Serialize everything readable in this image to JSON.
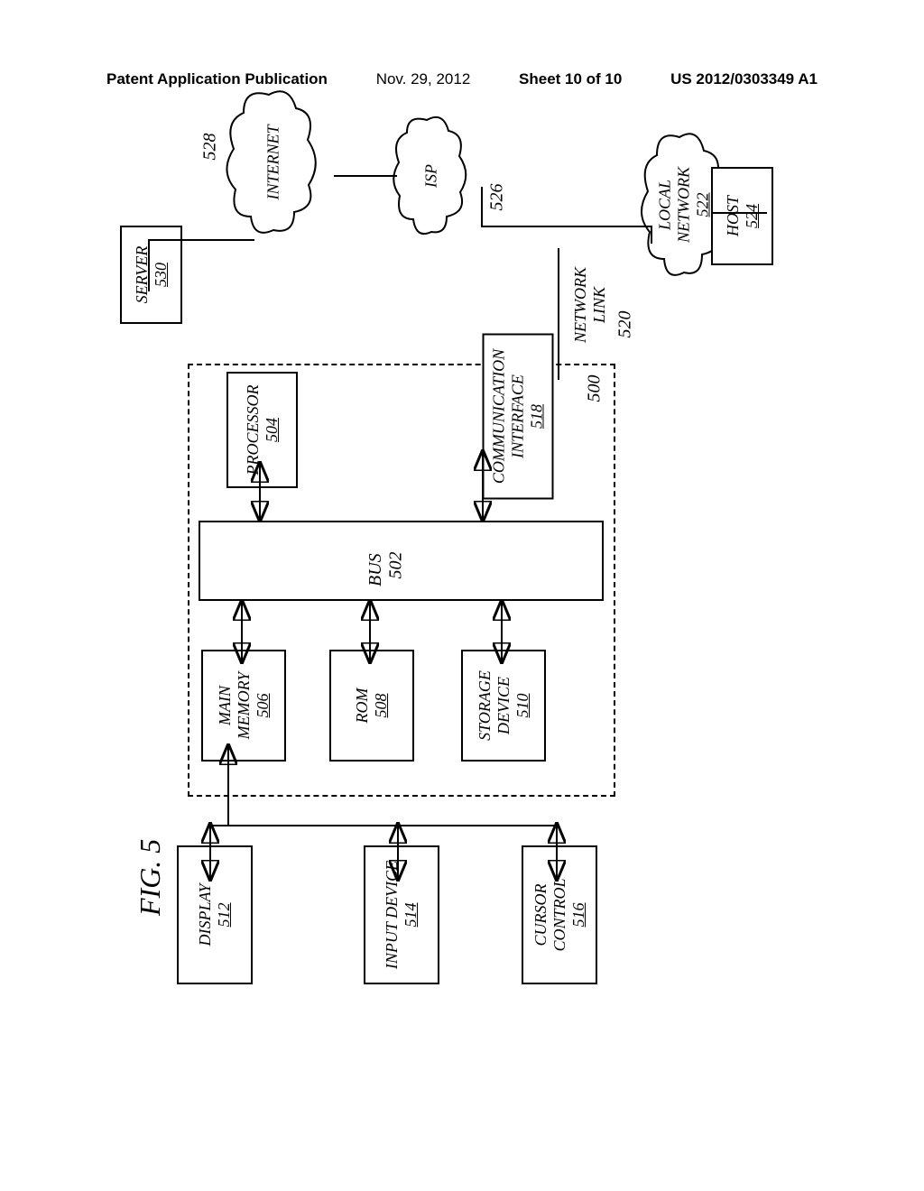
{
  "header": {
    "left": "Patent Application Publication",
    "date": "Nov. 29, 2012",
    "sheet": "Sheet 10 of 10",
    "pub": "US 2012/0303349 A1"
  },
  "figure_label": "FIG. 5",
  "boxes": {
    "display": {
      "label": "DISPLAY",
      "ref": "512"
    },
    "input": {
      "label": "INPUT DEVICE",
      "ref": "514"
    },
    "cursor": {
      "label1": "CURSOR",
      "label2": "CONTROL",
      "ref": "516"
    },
    "main_memory": {
      "label1": "MAIN",
      "label2": "MEMORY",
      "ref": "506"
    },
    "rom": {
      "label": "ROM",
      "ref": "508"
    },
    "storage": {
      "label1": "STORAGE",
      "label2": "DEVICE",
      "ref": "510"
    },
    "processor": {
      "label": "PROCESSOR",
      "ref": "504"
    },
    "comm": {
      "label1": "COMMUNICATION",
      "label2": "INTERFACE",
      "ref": "518"
    },
    "server": {
      "label": "SERVER",
      "ref": "530"
    },
    "host": {
      "label": "HOST",
      "ref": "524"
    }
  },
  "bus": {
    "label": "BUS",
    "ref": "502"
  },
  "system_ref": "500",
  "clouds": {
    "internet": {
      "label": "INTERNET",
      "ref": "528"
    },
    "isp": {
      "label": "ISP",
      "ref": "526"
    },
    "local_network": {
      "label1": "LOCAL",
      "label2": "NETWORK",
      "ref": "522"
    }
  },
  "network_link": {
    "label1": "NETWORK",
    "label2": "LINK",
    "ref": "520"
  }
}
